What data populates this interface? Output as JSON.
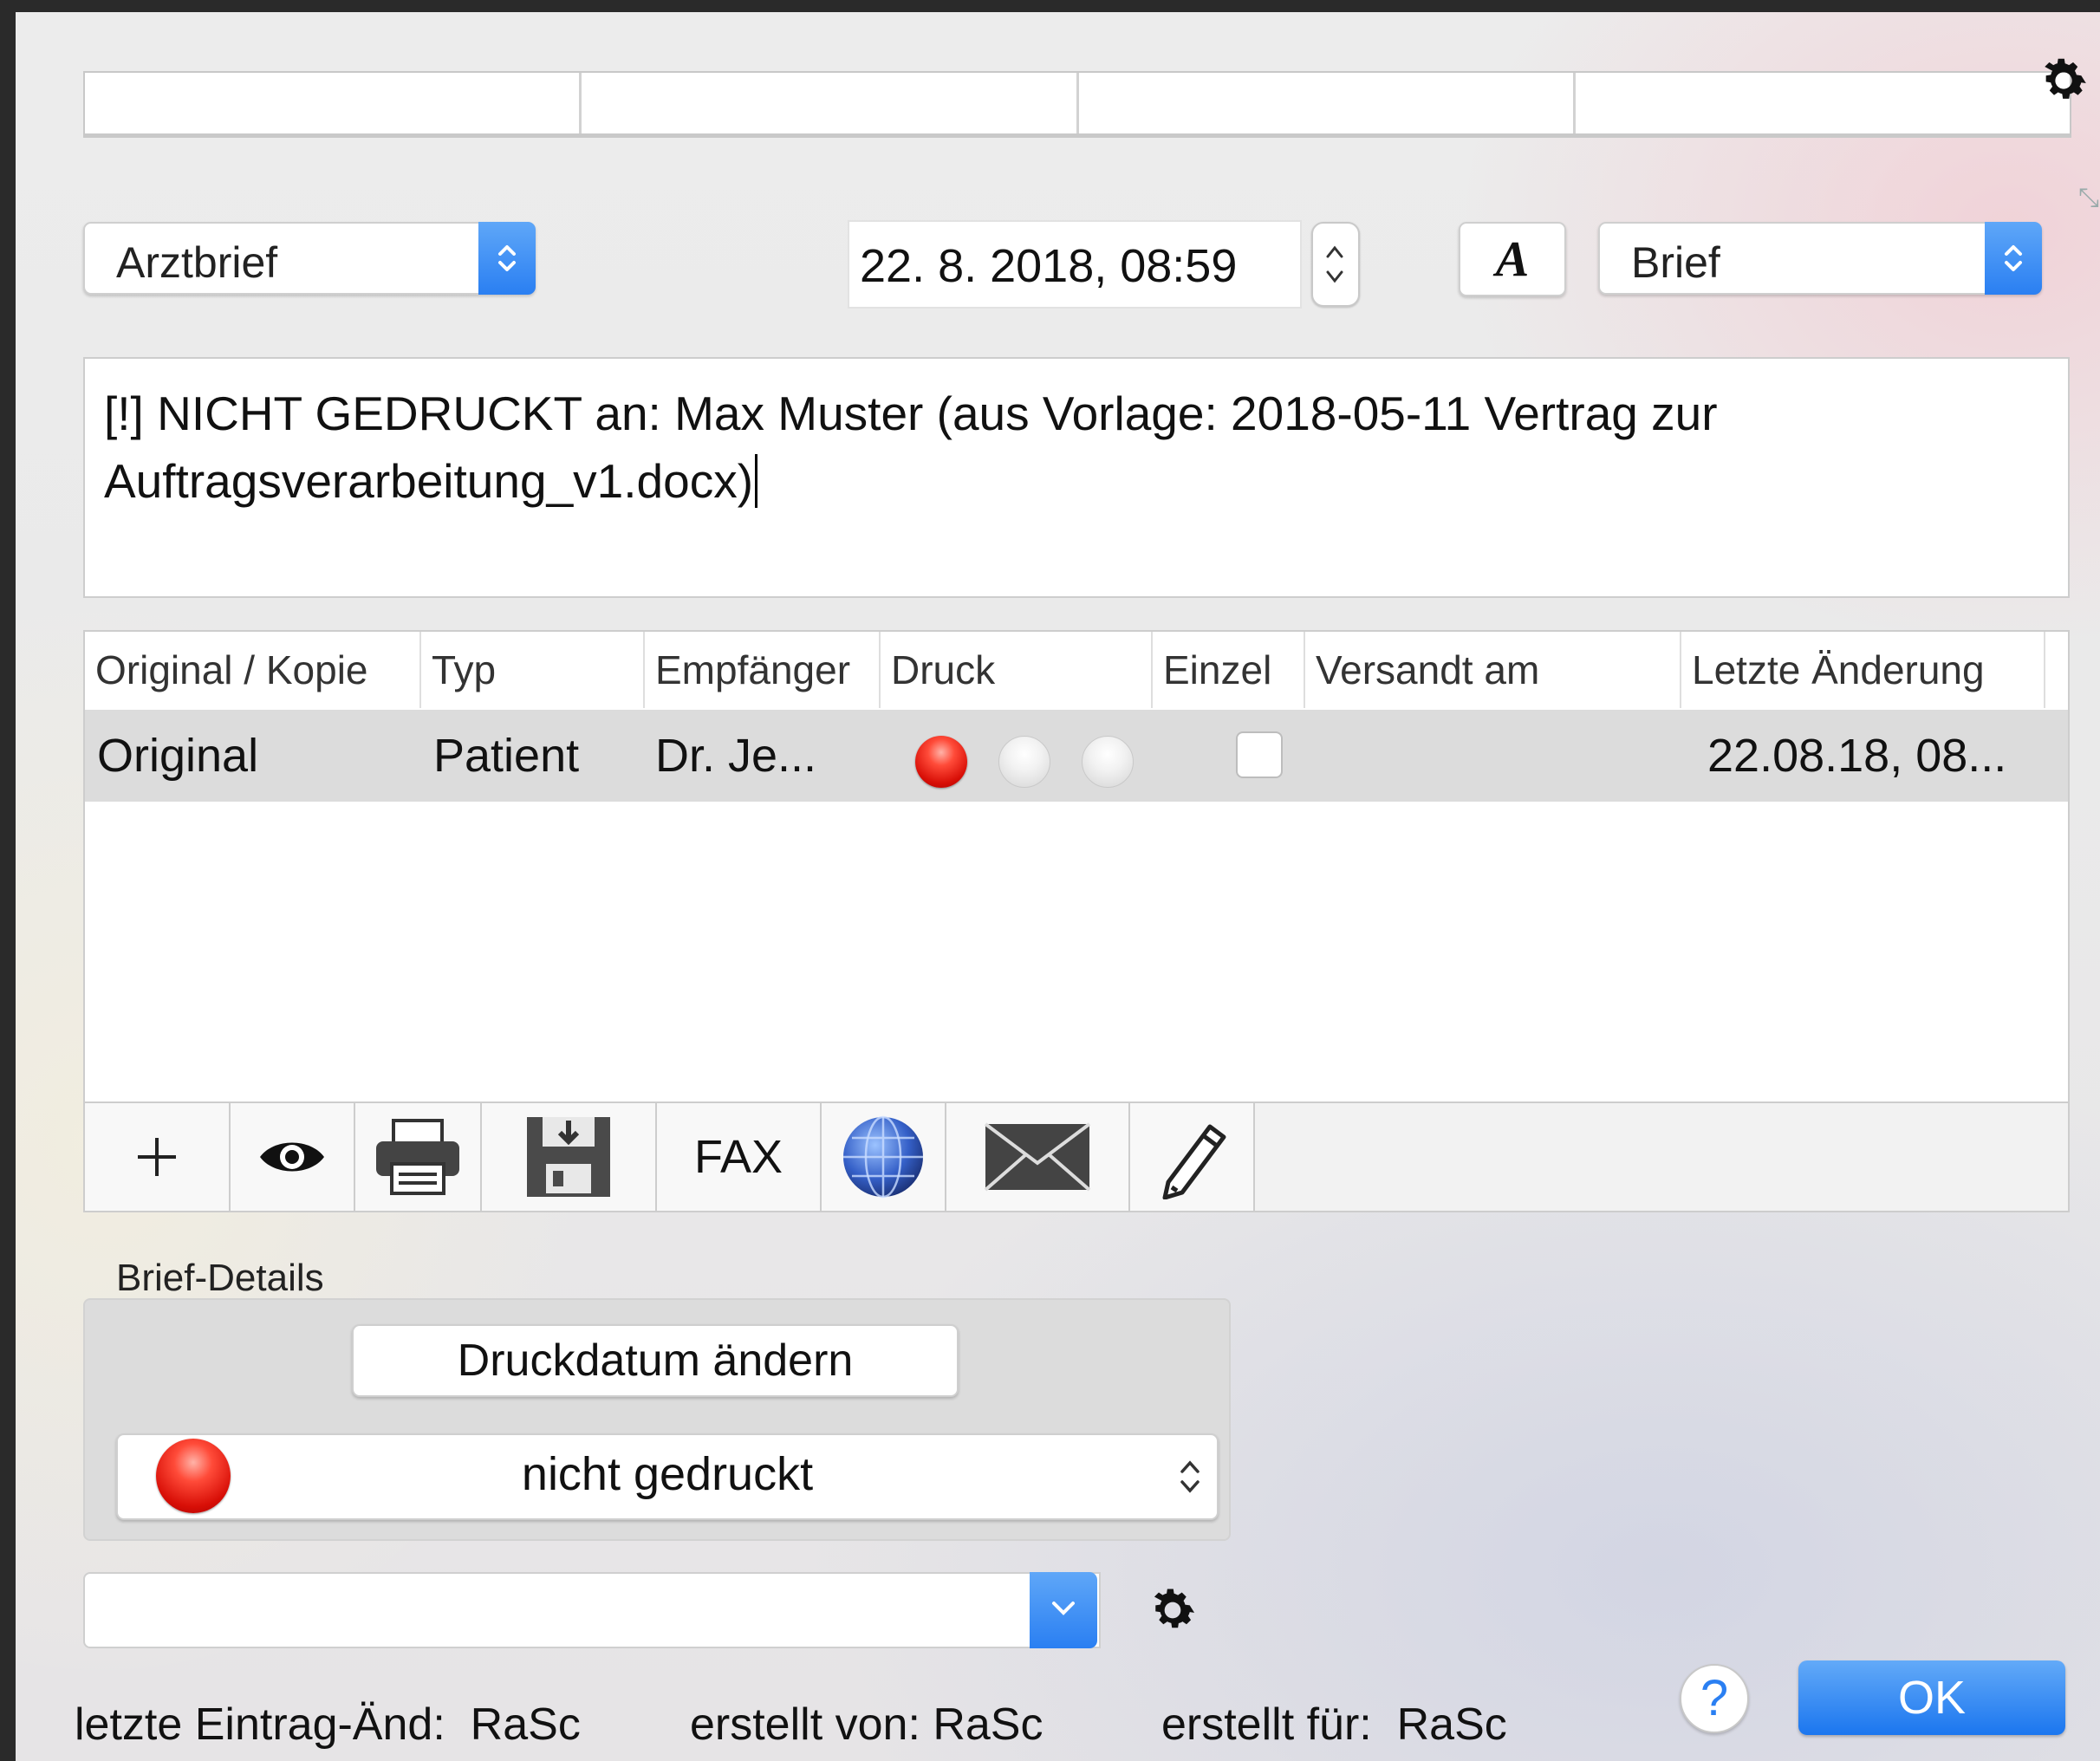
{
  "header": {
    "cells": [
      "",
      "",
      "",
      ""
    ]
  },
  "controls": {
    "doctype_popup": "Arztbrief",
    "date_value": "22.  8. 2018, 08:59",
    "font_button": "A",
    "category_popup": "Brief"
  },
  "subject": {
    "text": "[!] NICHT GEDRUCKT  an: Max Muster (aus Vorlage: 2018-05-11 Vertrag zur Auftragsverarbeitung_v1.docx)"
  },
  "table": {
    "columns": [
      "Original / Kopie",
      "Typ",
      "Empfänger",
      "Druck",
      "Einzel",
      "Versandt am",
      "Letzte Änderung"
    ],
    "rows": [
      {
        "original": "Original",
        "typ": "Patient",
        "empfaenger": "Dr. Je...",
        "druck": [
          "red",
          "off",
          "off"
        ],
        "einzel": false,
        "versandt": "",
        "letzte": "22.08.18, 08..."
      }
    ]
  },
  "toolbar": {
    "add": "+",
    "fax": "FAX",
    "icons": [
      "plus-icon",
      "eye-icon",
      "printer-icon",
      "save-disk-icon",
      "fax",
      "globe-icon",
      "envelope-icon",
      "pencil-icon"
    ]
  },
  "details": {
    "title": "Brief-Details",
    "change_date_button": "Druckdatum ändern",
    "status_popup": "nicht gedruckt"
  },
  "footer": {
    "last_change": "letzte Eintrag-Änd:  RaSc",
    "created_by": "erstellt von: RaSc",
    "created_for": "erstellt für:  RaSc",
    "help": "?",
    "ok": "OK"
  },
  "colors": {
    "accent": "#2a7ff2",
    "status_red": "#e0190d",
    "selected_row": "#dcdcdc"
  }
}
